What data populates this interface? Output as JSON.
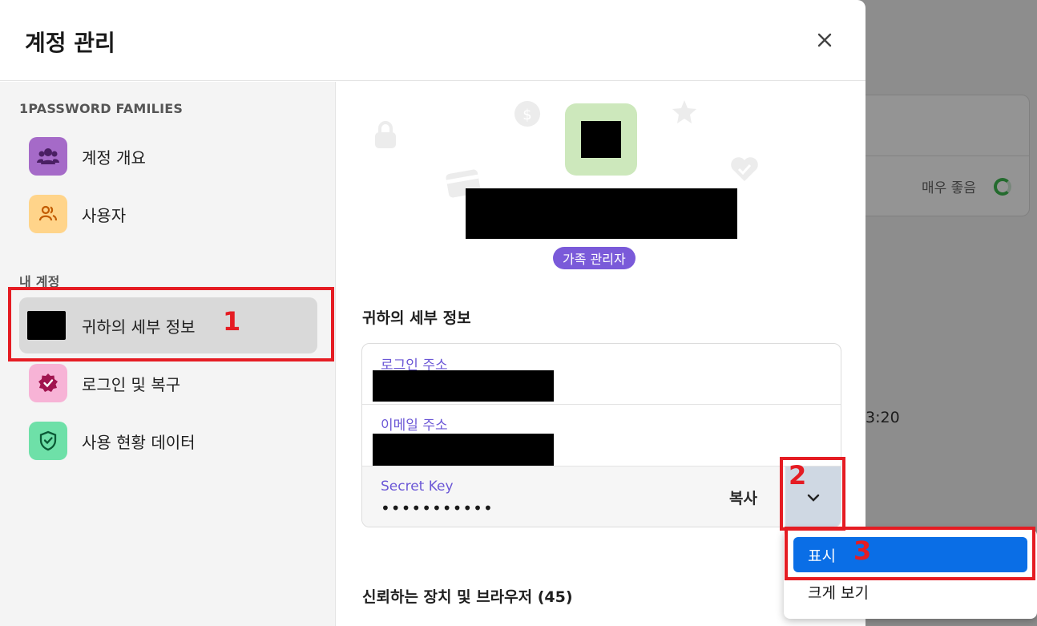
{
  "background": {
    "rating_text": "매우 좋음",
    "time_fragment": "3:20"
  },
  "modal": {
    "title": "계정 관리",
    "close_icon": "close-icon"
  },
  "sidebar": {
    "sections": [
      {
        "label": "1PASSWORD FAMILIES",
        "items": [
          {
            "label": "계정 개요",
            "icon": "group-icon",
            "color": "#a56ac8"
          },
          {
            "label": "사용자",
            "icon": "users-icon",
            "color": "#ffd48a"
          }
        ]
      },
      {
        "label": "내 계정",
        "items": [
          {
            "label": "귀하의 세부 정보",
            "icon": "avatar-icon",
            "active": true
          },
          {
            "label": "로그인 및 복구",
            "icon": "badge-check-icon",
            "color": "#f7b3d6"
          },
          {
            "label": "사용 현황 데이터",
            "icon": "shield-check-icon",
            "color": "#6ee0a8"
          }
        ]
      }
    ]
  },
  "profile": {
    "role_badge": "가족 관리자",
    "badge_color": "#7a5ad9",
    "avatar_color": "#cde8bc"
  },
  "details": {
    "heading": "귀하의 세부 정보",
    "login_address_label": "로그인 주소",
    "email_label": "이메일 주소",
    "secret_key_label": "Secret Key",
    "secret_key_value": "•••••••••••",
    "copy_label": "복사"
  },
  "devices": {
    "heading": "신뢰하는 장치 및 브라우저 (45)"
  },
  "dropdown": {
    "items": [
      {
        "label": "표시",
        "selected": true
      },
      {
        "label": "크게 보기",
        "selected": false
      }
    ]
  },
  "annotations": [
    "1",
    "2",
    "3"
  ],
  "colors": {
    "accent": "#0a6ee6",
    "label_purple": "#6b57d6",
    "annotation_red": "#e51c23"
  }
}
